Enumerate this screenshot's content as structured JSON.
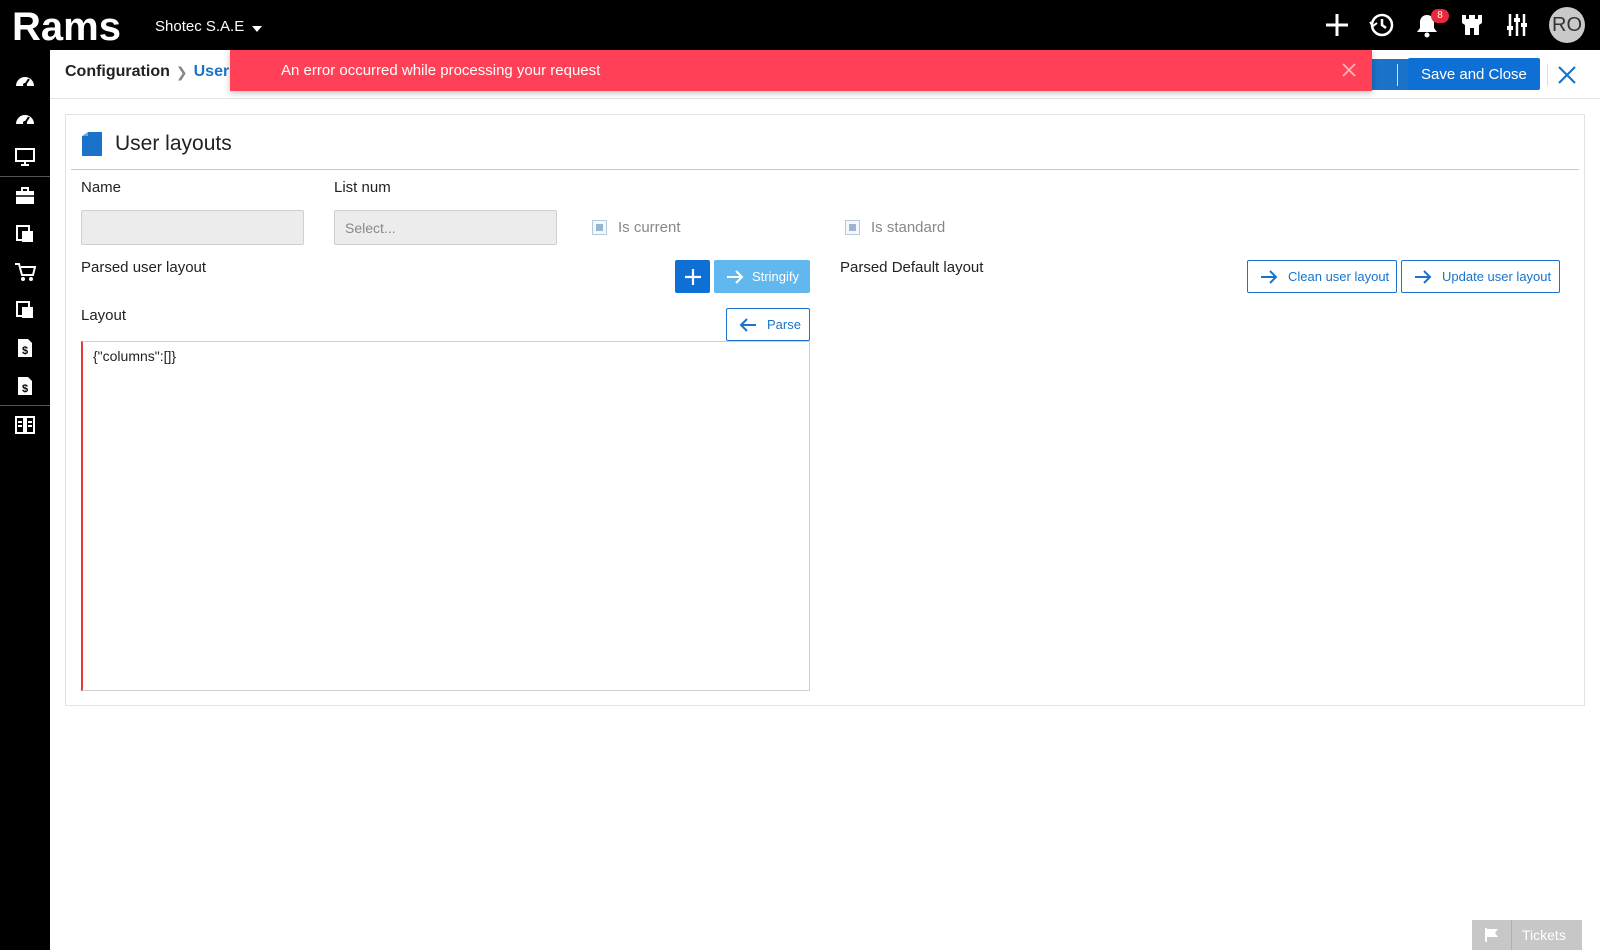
{
  "app": {
    "logo_text": "Rams",
    "company": "Shotec S.A.E",
    "notification_count": "8",
    "avatar_initials": "RO"
  },
  "header": {
    "breadcrumb_root": "Configuration",
    "breadcrumb_current": "User",
    "save_close_label": "Save and Close"
  },
  "toast": {
    "message": "An error occurred while processing your request"
  },
  "form": {
    "title": "User layouts",
    "name_label": "Name",
    "name_value": "",
    "list_num_label": "List num",
    "list_num_placeholder": "Select...",
    "is_current_label": "Is current",
    "is_standard_label": "Is standard",
    "parsed_user_layout_label": "Parsed user layout",
    "stringify_label": "Stringify",
    "parsed_default_layout_label": "Parsed Default layout",
    "clean_user_layout_label": "Clean user layout",
    "update_user_layout_label": "Update user layout",
    "layout_label": "Layout",
    "parse_label": "Parse",
    "layout_value": "{\"columns\":[]}"
  },
  "footer": {
    "tickets_label": "Tickets"
  },
  "colors": {
    "primary": "#0e6fd4",
    "error": "#ff4056",
    "topbar": "#000000"
  }
}
